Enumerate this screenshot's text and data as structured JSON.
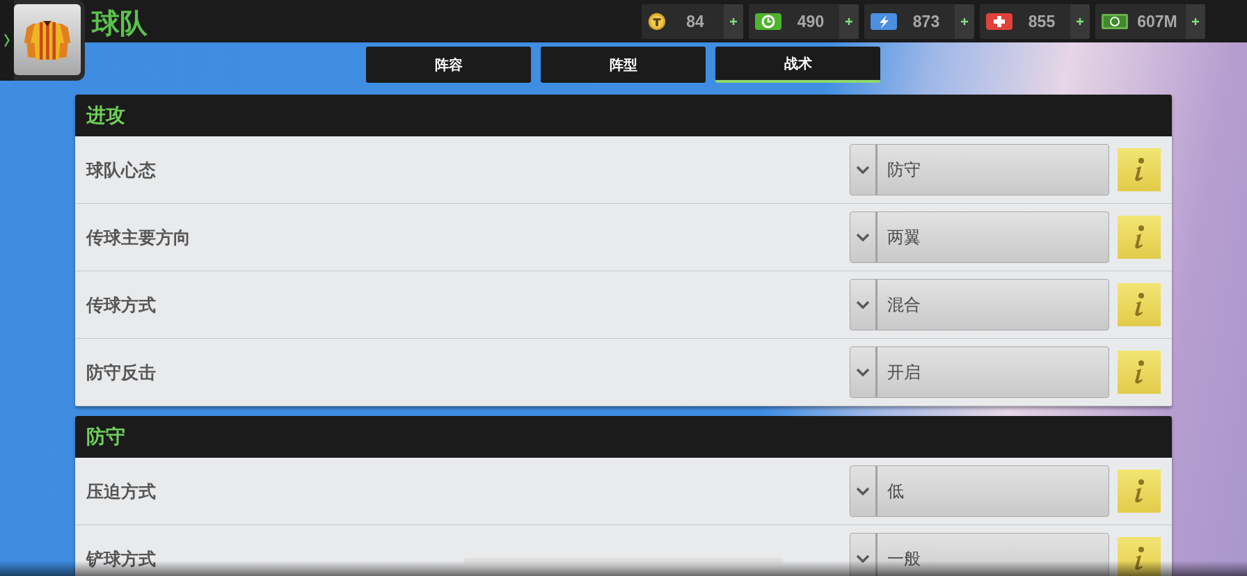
{
  "header": {
    "title": "球队"
  },
  "currencies": [
    {
      "kind": "coin",
      "value": "84"
    },
    {
      "kind": "clock",
      "value": "490"
    },
    {
      "kind": "energy",
      "value": "873"
    },
    {
      "kind": "health",
      "value": "855"
    },
    {
      "kind": "cash",
      "value": "607M"
    }
  ],
  "tabs": [
    {
      "label": "阵容",
      "selected": false
    },
    {
      "label": "阵型",
      "selected": false
    },
    {
      "label": "战术",
      "selected": true
    }
  ],
  "sections": [
    {
      "title": "进攻",
      "rows": [
        {
          "label": "球队心态",
          "value": "防守"
        },
        {
          "label": "传球主要方向",
          "value": "两翼"
        },
        {
          "label": "传球方式",
          "value": "混合"
        },
        {
          "label": "防守反击",
          "value": "开启"
        }
      ]
    },
    {
      "title": "防守",
      "rows": [
        {
          "label": "压迫方式",
          "value": "低"
        },
        {
          "label": "铲球方式",
          "value": "一般"
        }
      ]
    }
  ]
}
